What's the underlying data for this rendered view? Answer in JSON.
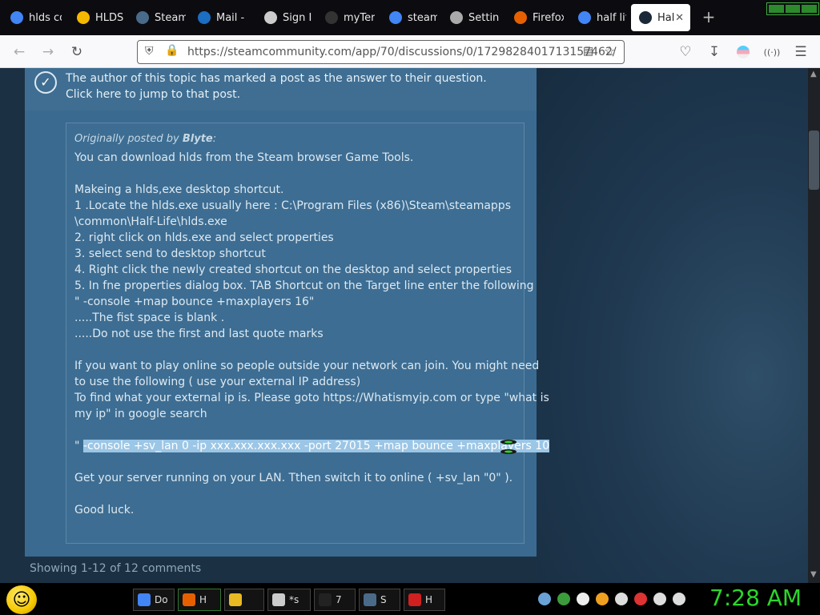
{
  "browser": {
    "tabs": [
      {
        "label": "hlds co",
        "icon": "google-icon",
        "color": "#4285f4"
      },
      {
        "label": "HLDSU",
        "icon": "hldsupdate-icon",
        "color": "#f5b800"
      },
      {
        "label": "Steam",
        "icon": "steam-icon",
        "color": "#4a6a8a"
      },
      {
        "label": "Mail -",
        "icon": "outlook-icon",
        "color": "#1b6ec2"
      },
      {
        "label": "Sign In",
        "icon": "person-icon",
        "color": "#cccccc"
      },
      {
        "label": "myTer",
        "icon": "myterm-icon",
        "color": "#333333"
      },
      {
        "label": "steam",
        "icon": "google-icon",
        "color": "#4285f4"
      },
      {
        "label": "Setting",
        "icon": "gear-icon",
        "color": "#aaaaaa"
      },
      {
        "label": "Firefox",
        "icon": "firefox-icon",
        "color": "#e66000"
      },
      {
        "label": "half lif",
        "icon": "google-icon",
        "color": "#4285f4"
      },
      {
        "label": "Hal",
        "icon": "steam-icon",
        "color": "#1b2838",
        "active": true
      }
    ],
    "url": "https://steamcommunity.com/app/70/discussions/0/1729828401713157462/"
  },
  "page": {
    "answer_notice_line1": "The author of this topic has marked a post as the answer to their question.",
    "answer_notice_line2": "Click here to jump to that post.",
    "quote_prefix": "Originally posted by",
    "quote_author": "Blyte",
    "quote_suffix": ":",
    "quote_lines": [
      "You can download hlds from the Steam browser Game Tools.",
      "",
      "Makeing a hlds,exe desktop shortcut.",
      "1 .Locate the hlds.exe usually here : C:\\Program Files (x86)\\Steam\\steamapps",
      "\\common\\Half-Life\\hlds.exe",
      "2. right click on hlds.exe and select properties",
      "3. select send to desktop shortcut",
      "4. Right click the newly created shortcut on the desktop and select properties",
      "5. In fne properties dialog box. TAB Shortcut on the Target line enter the following",
      "\" -console +map bounce +maxplayers 16\"",
      ".....The fist space is blank .",
      ".....Do not use the first and last quote marks",
      "",
      "If you want to play online so people outside your network can join. You might need",
      "to use the following ( use your external IP address)",
      "To find what your external ip is. Please goto https://Whatismyip.com or type \"what is",
      "my ip\" in google search",
      "",
      "",
      "",
      "Get your server running on your LAN. Tthen switch it to online ( +sv_lan \"0\" ).",
      "",
      "Good luck."
    ],
    "highlight_prefix": "\"",
    "highlight_line": "-console +sv_lan 0 -ip xxx.xxx.xxx.xxx -port 27015 +map bounce +maxplayers 10",
    "showing": "Showing 1-12 of 12 comments"
  },
  "taskbar": {
    "items": [
      {
        "label": "Do",
        "icon": "chrome-icon",
        "color": "#4285f4"
      },
      {
        "label": "H",
        "icon": "firefox-icon",
        "color": "#e66000",
        "active": true
      },
      {
        "label": "",
        "icon": "folder-icon",
        "color": "#e8b923"
      },
      {
        "label": "*s",
        "icon": "notepad-icon",
        "color": "#cccccc"
      },
      {
        "label": "7",
        "icon": "7zip-icon",
        "color": "#222222"
      },
      {
        "label": "S",
        "icon": "steam-icon",
        "color": "#4a6a8a"
      },
      {
        "label": "H",
        "icon": "halflife-icon",
        "color": "#d02020"
      }
    ],
    "tray_icons": [
      "steam-tray-icon",
      "network-globe-icon",
      "soccer-ball-icon",
      "search-icon",
      "chat-icon",
      "flag-icon",
      "display-icon",
      "volume-icon"
    ],
    "clock": "7:28 AM"
  },
  "colors": {
    "accent_green": "#2bd62b",
    "steam_panel": "#3a6a90",
    "steam_bg": "#1b3143"
  }
}
